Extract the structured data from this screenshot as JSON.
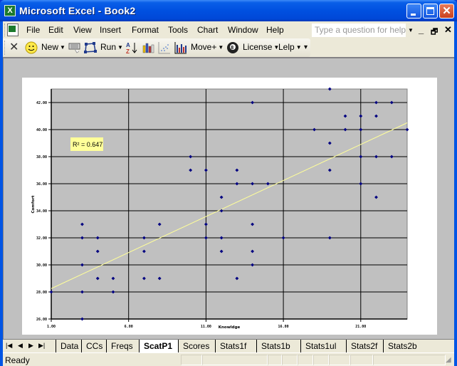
{
  "window": {
    "title": "Microsoft Excel - Book2"
  },
  "menubar": {
    "items": [
      "File",
      "Edit",
      "View",
      "Insert",
      "Format",
      "Tools",
      "Chart",
      "Window",
      "Help"
    ],
    "help_placeholder": "Type a question for help"
  },
  "toolbar": {
    "new_label": "New",
    "run_label": "Run",
    "move_label": "Move+",
    "license_label": "License",
    "lelp_label": "Lelp"
  },
  "sheet_tabs": [
    "Data",
    "CCs",
    "Freqs",
    "ScatP1",
    "Scores",
    "Stats1f",
    "Stats1b",
    "Stats1ul",
    "Stats2f",
    "Stats2b"
  ],
  "active_tab": "ScatP1",
  "status": {
    "text": "Ready"
  },
  "chart_data": {
    "type": "scatter",
    "title": "",
    "xlabel": "Knowldge",
    "ylabel": "Comfort",
    "xlim": [
      1,
      24
    ],
    "ylim": [
      26,
      43
    ],
    "xticks": [
      1,
      6,
      11,
      16,
      21
    ],
    "xtick_labels": [
      "1.00",
      "6.00",
      "11.00",
      "16.00",
      "21.00"
    ],
    "yticks": [
      26,
      28,
      30,
      32,
      34,
      36,
      38,
      40,
      42
    ],
    "ytick_labels": [
      "26.00",
      "28.00",
      "30.00",
      "32.00",
      "34.00",
      "36.00",
      "38.00",
      "40.00",
      "42.00"
    ],
    "grid": true,
    "legend": "none",
    "marker_color": "#000080",
    "trendline": {
      "type": "linear",
      "color": "#ffff99",
      "x": [
        1,
        24
      ],
      "y": [
        28.25,
        40.5
      ]
    },
    "annotation": {
      "text": "R² = 0.647",
      "position": "top-left"
    },
    "points": [
      [
        1,
        28
      ],
      [
        3,
        33
      ],
      [
        3,
        32
      ],
      [
        3,
        30
      ],
      [
        3,
        28
      ],
      [
        3,
        26
      ],
      [
        4,
        32
      ],
      [
        4,
        31
      ],
      [
        4,
        29
      ],
      [
        5,
        29
      ],
      [
        5,
        28
      ],
      [
        7,
        32
      ],
      [
        7,
        31
      ],
      [
        7,
        29
      ],
      [
        8,
        33
      ],
      [
        8,
        29
      ],
      [
        10,
        38
      ],
      [
        10,
        37
      ],
      [
        11,
        37
      ],
      [
        11,
        33
      ],
      [
        11,
        32
      ],
      [
        12,
        35
      ],
      [
        12,
        34
      ],
      [
        12,
        32
      ],
      [
        12,
        31
      ],
      [
        13,
        37
      ],
      [
        13,
        36
      ],
      [
        13,
        29
      ],
      [
        14,
        42
      ],
      [
        14,
        36
      ],
      [
        14,
        33
      ],
      [
        14,
        31
      ],
      [
        14,
        30
      ],
      [
        15,
        36
      ],
      [
        16,
        32
      ],
      [
        18,
        40
      ],
      [
        19,
        43
      ],
      [
        19,
        39
      ],
      [
        19,
        37
      ],
      [
        19,
        32
      ],
      [
        20,
        41
      ],
      [
        20,
        40
      ],
      [
        21,
        41
      ],
      [
        21,
        40
      ],
      [
        21,
        38
      ],
      [
        21,
        36
      ],
      [
        22,
        42
      ],
      [
        22,
        41
      ],
      [
        22,
        38
      ],
      [
        22,
        35
      ],
      [
        23,
        42
      ],
      [
        23,
        38
      ],
      [
        24,
        40
      ]
    ]
  }
}
